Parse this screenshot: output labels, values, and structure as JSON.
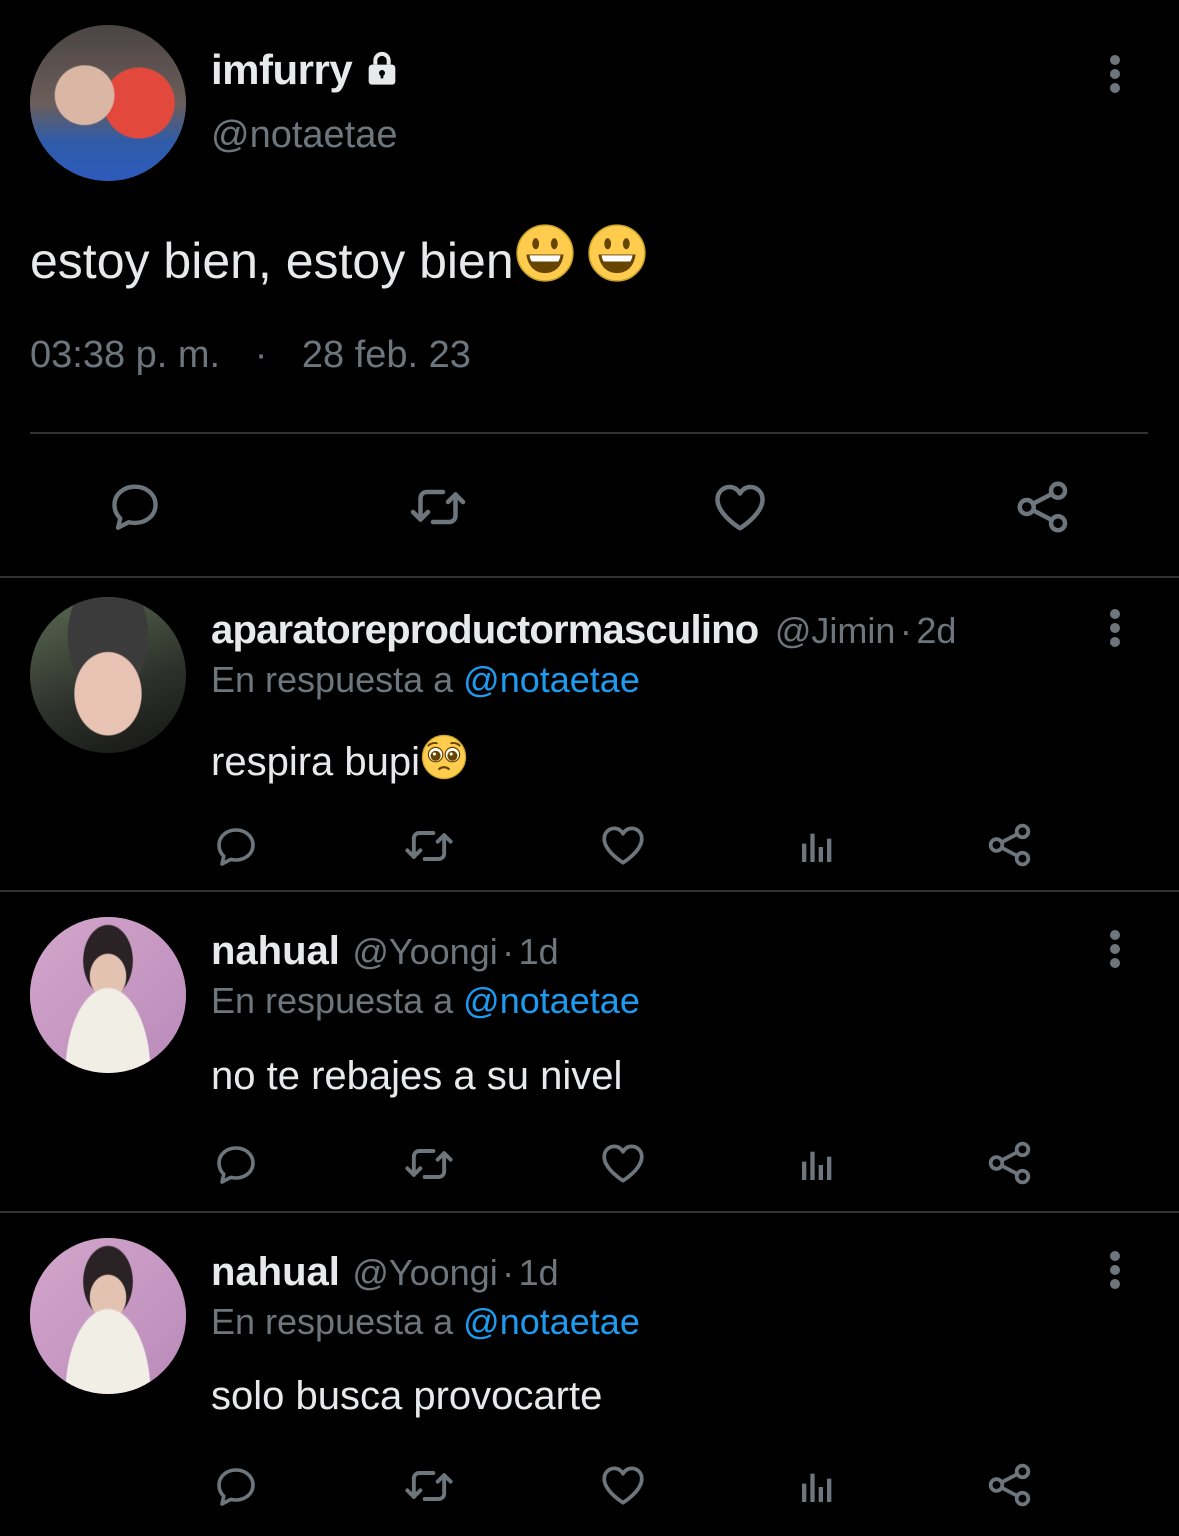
{
  "main_tweet": {
    "display_name": "imfurry",
    "handle": "@notaetae",
    "text": "estoy bien, estoy bien",
    "emoji": [
      "grinning-face-emoji",
      "grinning-face-emoji"
    ],
    "time": "03:38 p. m.",
    "separator": "·",
    "date": "28 feb. 23",
    "actions": [
      "reply-icon",
      "retweet-icon",
      "like-icon",
      "share-icon"
    ]
  },
  "replies": [
    {
      "display_name": "aparatoreproductormasculino",
      "handle": "@Jimin",
      "dot": "·",
      "age": "2d",
      "reply_prefix": "En respuesta a",
      "reply_to": "@notaetae",
      "text": "respira bupi",
      "emoji": "pleading-face-emoji"
    },
    {
      "display_name": "nahual",
      "handle": "@Yoongi",
      "dot": "·",
      "age": "1d",
      "reply_prefix": "En respuesta a",
      "reply_to": "@notaetae",
      "text": "no te rebajes a su nivel"
    },
    {
      "display_name": "nahual",
      "handle": "@Yoongi",
      "dot": "·",
      "age": "1d",
      "reply_prefix": "En respuesta a",
      "reply_to": "@notaetae",
      "text": "solo busca provocarte"
    }
  ],
  "reply_actions": [
    "reply-icon",
    "retweet-icon",
    "like-icon",
    "analytics-icon",
    "share-icon"
  ],
  "colors": {
    "background": "#000000",
    "text": "#e7e9ea",
    "secondary": "#6e767d",
    "link": "#1d9bf0",
    "divider": "#2f3336"
  }
}
